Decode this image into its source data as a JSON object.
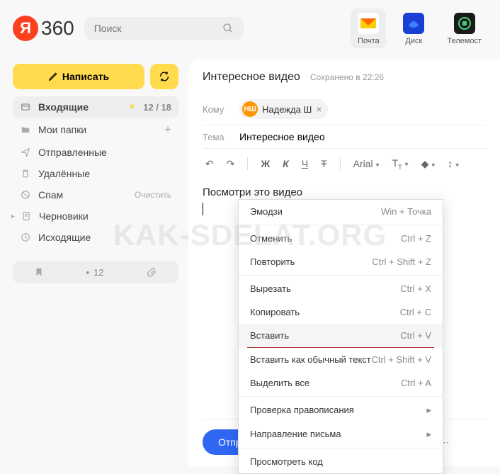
{
  "header": {
    "logo_text": "360",
    "logo_letter": "Я",
    "search_placeholder": "Поиск",
    "apps": [
      {
        "label": "Почта",
        "active": true
      },
      {
        "label": "Диск",
        "active": false
      },
      {
        "label": "Телемост",
        "active": false
      }
    ]
  },
  "sidebar": {
    "compose_label": "Написать",
    "folders": [
      {
        "icon": "inbox",
        "label": "Входящие",
        "unread": "12",
        "total": "18",
        "active": true
      },
      {
        "icon": "folder",
        "label": "Мои папки",
        "action": "+"
      },
      {
        "icon": "sent",
        "label": "Отправленные"
      },
      {
        "icon": "trash",
        "label": "Удалённые"
      },
      {
        "icon": "spam",
        "label": "Спам",
        "clear": "Очистить"
      },
      {
        "icon": "drafts",
        "label": "Черновики",
        "expandable": true
      },
      {
        "icon": "outbox",
        "label": "Исходящие"
      }
    ],
    "bottom_count": "12"
  },
  "compose": {
    "title": "Интересное видео",
    "saved": "Сохранено в 22:26",
    "to_label": "Кому",
    "recipient": {
      "initials": "НШ",
      "name": "Надежда Ш"
    },
    "subject_label": "Тема",
    "subject_value": "Интересное видео",
    "toolbar": {
      "font": "Arial"
    },
    "body_text": "Посмотри это видео",
    "send_label": "Отправить"
  },
  "context_menu": {
    "items": [
      {
        "label": "Эмодзи",
        "shortcut": "Win + Точка"
      },
      {
        "sep": true
      },
      {
        "label": "Отменить",
        "shortcut": "Ctrl + Z"
      },
      {
        "label": "Повторить",
        "shortcut": "Ctrl + Shift + Z"
      },
      {
        "sep": true
      },
      {
        "label": "Вырезать",
        "shortcut": "Ctrl + X"
      },
      {
        "label": "Копировать",
        "shortcut": "Ctrl + C"
      },
      {
        "label": "Вставить",
        "shortcut": "Ctrl + V",
        "highlighted": true,
        "underline": true
      },
      {
        "label": "Вставить как обычный текст",
        "shortcut": "Ctrl + Shift + V"
      },
      {
        "label": "Выделить все",
        "shortcut": "Ctrl + A"
      },
      {
        "sep": true
      },
      {
        "label": "Проверка правописания",
        "submenu": true
      },
      {
        "label": "Направление письма",
        "submenu": true
      },
      {
        "sep": true
      },
      {
        "label": "Просмотреть код"
      }
    ]
  },
  "watermark": "KAK-SDELAT.ORG"
}
